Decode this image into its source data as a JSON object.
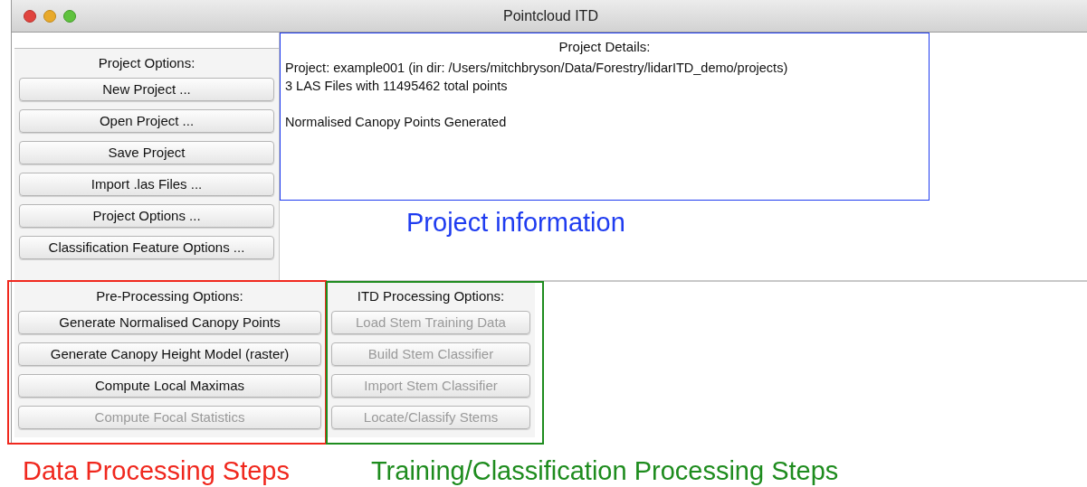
{
  "window": {
    "title": "Pointcloud ITD"
  },
  "project_options": {
    "heading": "Project Options:",
    "buttons": [
      {
        "label": "New Project ...",
        "disabled": false
      },
      {
        "label": "Open Project ...",
        "disabled": false
      },
      {
        "label": "Save Project",
        "disabled": false
      },
      {
        "label": "Import .las Files ...",
        "disabled": false
      },
      {
        "label": "Project Options ...",
        "disabled": false
      },
      {
        "label": "Classification Feature Options ...",
        "disabled": false
      }
    ]
  },
  "project_details": {
    "heading": "Project Details:",
    "paragraphs": [
      [
        "Project: example001 (in dir: /Users/mitchbryson/Data/Forestry/lidarITD_demo/projects)",
        "3 LAS Files with 11495462 total points"
      ],
      [
        "Normalised Canopy Points Generated"
      ]
    ]
  },
  "pre_processing": {
    "heading": "Pre-Processing Options:",
    "buttons": [
      {
        "label": "Generate Normalised Canopy Points",
        "disabled": false
      },
      {
        "label": "Generate Canopy Height Model (raster)",
        "disabled": false
      },
      {
        "label": "Compute Local Maximas",
        "disabled": false
      },
      {
        "label": "Compute Focal Statistics",
        "disabled": true
      }
    ]
  },
  "itd_processing": {
    "heading": "ITD Processing Options:",
    "buttons": [
      {
        "label": "Load Stem Training Data",
        "disabled": true
      },
      {
        "label": "Build Stem Classifier",
        "disabled": true
      },
      {
        "label": "Import Stem Classifier",
        "disabled": true
      },
      {
        "label": "Locate/Classify Stems",
        "disabled": true
      }
    ]
  },
  "annotations": {
    "project_information": {
      "text": "Project information",
      "color": "#1f3cf0"
    },
    "data_processing": {
      "text": "Data Processing Steps",
      "color": "#f0281e"
    },
    "training_classification": {
      "text": "Training/Classification Processing Steps",
      "color": "#1e8c1e"
    }
  }
}
